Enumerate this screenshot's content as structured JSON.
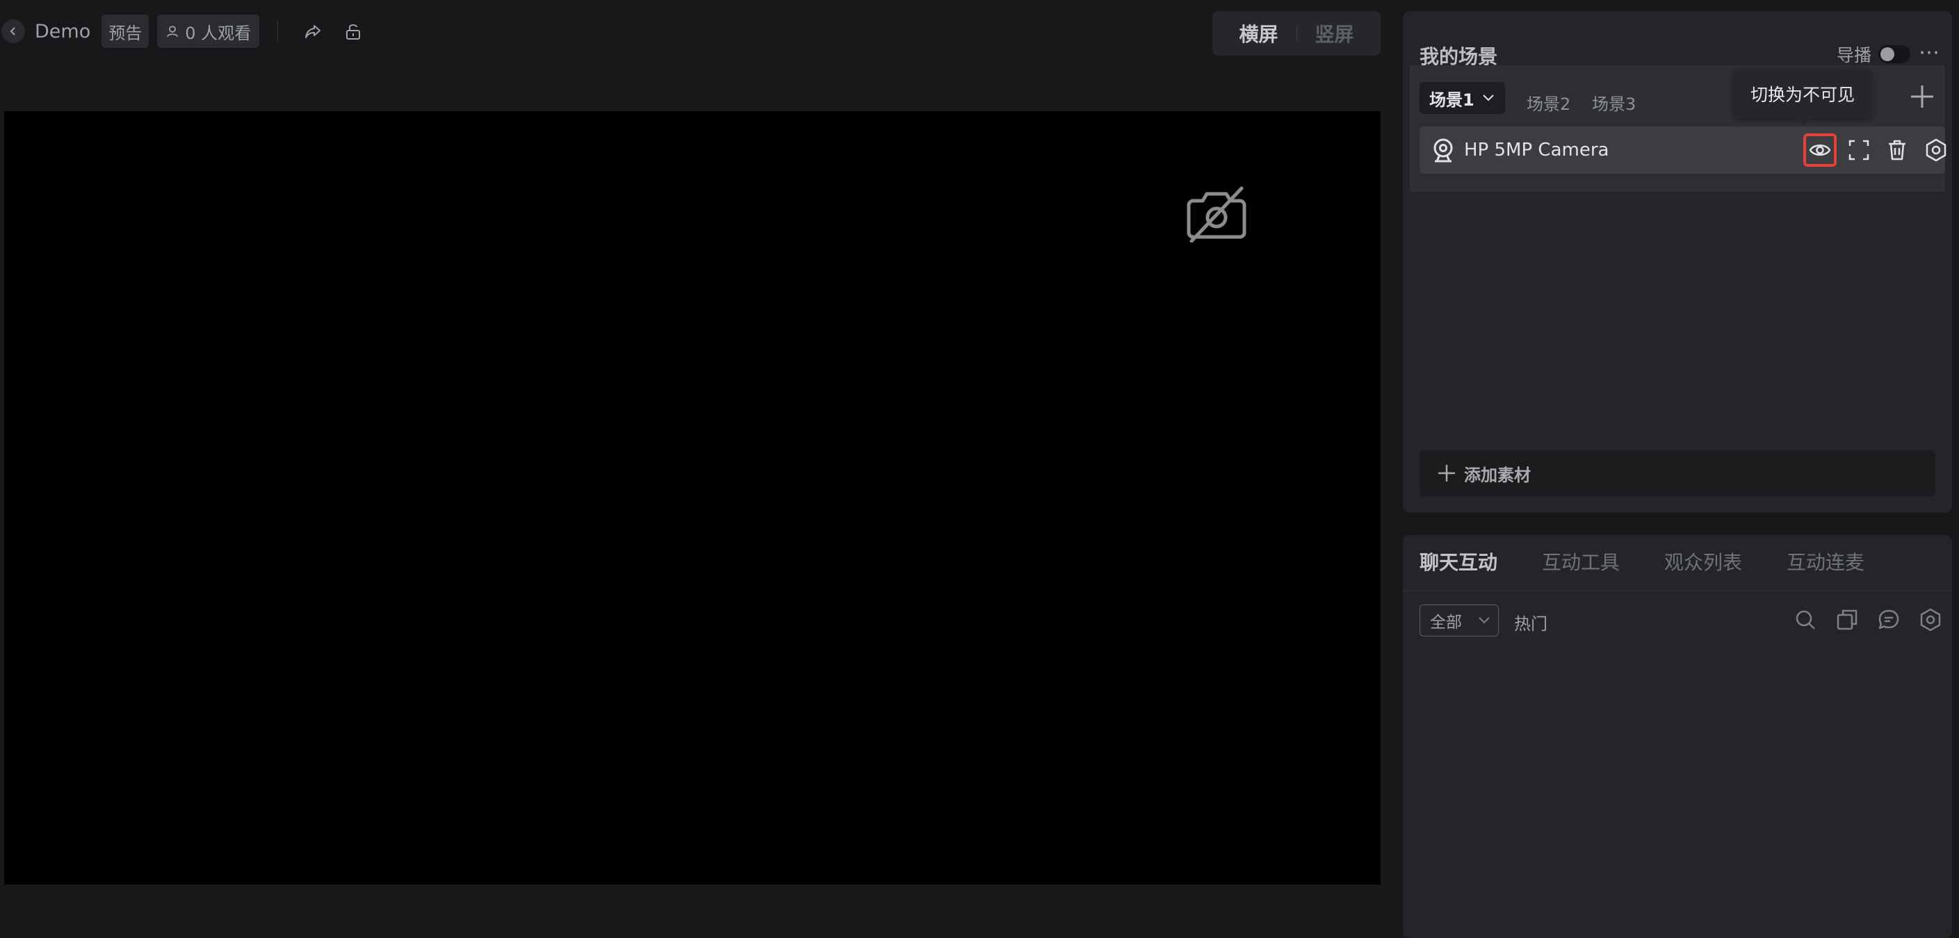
{
  "header": {
    "title": "Demo",
    "status_tag": "预告",
    "viewers": "0 人观看"
  },
  "orientation": {
    "landscape": "横屏",
    "portrait": "竖屏",
    "selected": "横屏"
  },
  "scenes_panel": {
    "title": "我的场景",
    "director_label": "导播",
    "director_enabled": false,
    "tabs": [
      {
        "label": "场景1",
        "active": true
      },
      {
        "label": "场景2",
        "active": false
      },
      {
        "label": "场景3",
        "active": false
      }
    ],
    "tooltip": "切换为不可见",
    "sources": [
      {
        "name": "HP 5MP Camera",
        "icon": "webcam-icon"
      }
    ],
    "add_material_label": "添加素材"
  },
  "chat_panel": {
    "tabs": [
      {
        "label": "聊天互动",
        "active": true
      },
      {
        "label": "互动工具",
        "active": false
      },
      {
        "label": "观众列表",
        "active": false
      },
      {
        "label": "互动连麦",
        "active": false
      }
    ],
    "filter_value": "全部",
    "hot_label": "热门"
  },
  "colors": {
    "background": "#17181a",
    "panel": "#242528",
    "highlight": "#e8413a"
  }
}
